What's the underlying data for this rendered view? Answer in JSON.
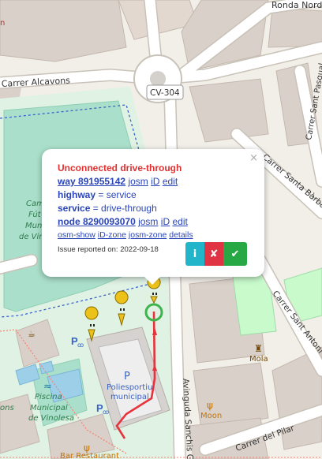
{
  "map": {
    "streets": {
      "ronda_nord": "Ronda Nord",
      "carrer_alcavons": "Carrer Alcavons",
      "cv304": "CV-304",
      "sant_pasqual": "Carrer Sant Pasqual",
      "santa_barbara": "Carrer Santa Bàrbara",
      "sant_antoni": "Carrer Sant Antoni",
      "avinguda_sanchis": "Avinguda Sanchis Gu",
      "carrer_del_pilar": "Carrer del Pilar"
    },
    "pois": {
      "campo_line1": "Cam",
      "campo_line2": "Fút",
      "campo_line3": "Muni",
      "campo_line4": "de Vin",
      "piscina_line1": "Piscina",
      "piscina_line2": "Municipal",
      "piscina_line3": "de Vinolesa",
      "poliesportiu_p": "P",
      "poliesportiu_line1": "Poliesportiu",
      "poliesportiu_line2": "municipal",
      "mola": "Mola",
      "moon": "Moon",
      "bar_restaurant": "Bar Restaurant",
      "ons": "ons",
      "edge_top_left": "n"
    }
  },
  "popup": {
    "close": "×",
    "title": "Unconnected drive-through",
    "way_label": "way 891955142",
    "josm": "josm",
    "id": "iD",
    "edit": "edit",
    "highway_key": "highway",
    "highway_value": "= service",
    "service_key": "service",
    "service_value": "= drive-through",
    "node_label": "node 8290093070",
    "osm_show": "osm-show",
    "id_zone": "iD-zone",
    "josm_zone": "josm-zone",
    "details": "details",
    "issue_reported": "Issue reported on: 2022-09-18",
    "btn_info": "i",
    "btn_reject": "✘",
    "btn_accept": "✔"
  },
  "colors": {
    "land": "#f2efe9",
    "road": "#ffffff",
    "sports": "#dff2e4",
    "pitch": "#aae0cb",
    "building": "#d9d0c9",
    "park": "#c8facc",
    "route": "#e8323c",
    "marker_ring": "#3cb44b",
    "pin": "#ecc11a"
  }
}
